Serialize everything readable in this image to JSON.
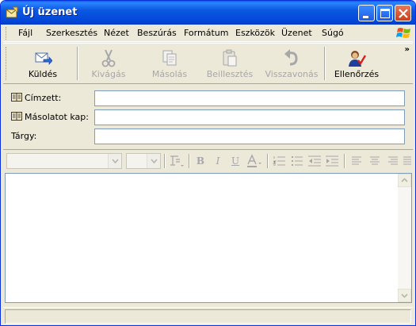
{
  "window": {
    "title": "Új üzenet",
    "accent": "#0A5FEA"
  },
  "menu": {
    "items": [
      "Fájl",
      "Szerkesztés",
      "Nézet",
      "Beszúrás",
      "Formátum",
      "Eszközök",
      "Üzenet",
      "Súgó"
    ]
  },
  "toolbar": {
    "buttons": [
      {
        "label": "Küldés",
        "icon": "send-icon",
        "enabled": true
      },
      {
        "label": "Kivágás",
        "icon": "scissors-icon",
        "enabled": false
      },
      {
        "label": "Másolás",
        "icon": "copy-icon",
        "enabled": false
      },
      {
        "label": "Beillesztés",
        "icon": "paste-icon",
        "enabled": false
      },
      {
        "label": "Visszavonás",
        "icon": "undo-icon",
        "enabled": false
      },
      {
        "label": "Ellenőrzés",
        "icon": "check-names-icon",
        "enabled": true
      }
    ],
    "more": "»"
  },
  "fields": {
    "to_label": "Címzett:",
    "to_value": "",
    "cc_label": "Másolatot kap:",
    "cc_value": "",
    "subject_label": "Tárgy:",
    "subject_value": ""
  },
  "format": {
    "font_value": "",
    "size_value": "",
    "bold": "B",
    "italic": "I",
    "underline": "U"
  },
  "body": {
    "text": ""
  }
}
